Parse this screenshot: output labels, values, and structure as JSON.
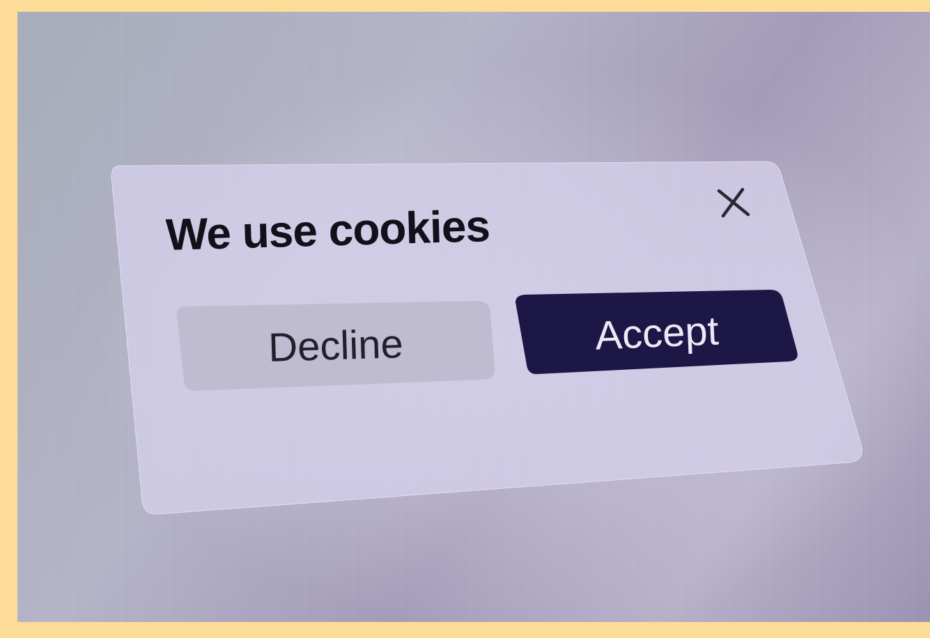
{
  "dialog": {
    "title": "We use cookies",
    "close_icon": "close-icon",
    "decline_label": "Decline",
    "accept_label": "Accept"
  },
  "colors": {
    "frame": "#fddc97",
    "panel": "#d5d0ea",
    "decline_bg": "#bfbbd0",
    "accept_bg": "#1d1745",
    "title_text": "#121018",
    "accept_text": "#ece9f6"
  }
}
